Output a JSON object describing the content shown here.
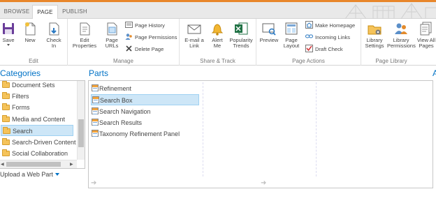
{
  "tabs": [
    {
      "label": "BROWSE",
      "active": false
    },
    {
      "label": "PAGE",
      "active": true
    },
    {
      "label": "PUBLISH",
      "active": false
    }
  ],
  "ribbon": {
    "edit": {
      "label": "Edit",
      "save": "Save",
      "new": "New",
      "check_in_1": "Check",
      "check_in_2": "In"
    },
    "manage": {
      "label": "Manage",
      "edit_properties_1": "Edit",
      "edit_properties_2": "Properties",
      "page_urls_1": "Page",
      "page_urls_2": "URLs",
      "page_history": "Page History",
      "page_permissions": "Page Permissions",
      "delete_page": "Delete Page"
    },
    "share_track": {
      "label": "Share & Track",
      "email_link_1": "E-mail a",
      "email_link_2": "Link",
      "alert_me_1": "Alert",
      "alert_me_2": "Me",
      "popularity_trends_1": "Popularity",
      "popularity_trends_2": "Trends"
    },
    "page_actions": {
      "label": "Page Actions",
      "preview": "Preview",
      "page_layout_1": "Page",
      "page_layout_2": "Layout",
      "make_homepage": "Make Homepage",
      "incoming_links": "Incoming Links",
      "draft_check": "Draft Check"
    },
    "page_library": {
      "label": "Page Library",
      "library_settings_1": "Library",
      "library_settings_2": "Settings",
      "library_permissions_1": "Library",
      "library_permissions_2": "Permissions",
      "view_all_pages_1": "View All",
      "view_all_pages_2": "Pages"
    }
  },
  "categories": {
    "heading": "Categories",
    "items": [
      {
        "label": "Document Sets",
        "selected": false
      },
      {
        "label": "Filters",
        "selected": false
      },
      {
        "label": "Forms",
        "selected": false
      },
      {
        "label": "Media and Content",
        "selected": false
      },
      {
        "label": "Search",
        "selected": true
      },
      {
        "label": "Search-Driven Content",
        "selected": false
      },
      {
        "label": "Social Collaboration",
        "selected": false
      }
    ],
    "upload": "Upload a Web Part"
  },
  "parts": {
    "heading": "Parts",
    "items": [
      {
        "label": "Refinement",
        "selected": false
      },
      {
        "label": "Search Box",
        "selected": true
      },
      {
        "label": "Search Navigation",
        "selected": false
      },
      {
        "label": "Search Results",
        "selected": false
      },
      {
        "label": "Taxonomy Refinement Panel",
        "selected": false
      }
    ]
  },
  "about_heading": "A",
  "colors": {
    "accent": "#0072c6",
    "tab_border": "#e8862b",
    "selection": "#cde6f7"
  }
}
